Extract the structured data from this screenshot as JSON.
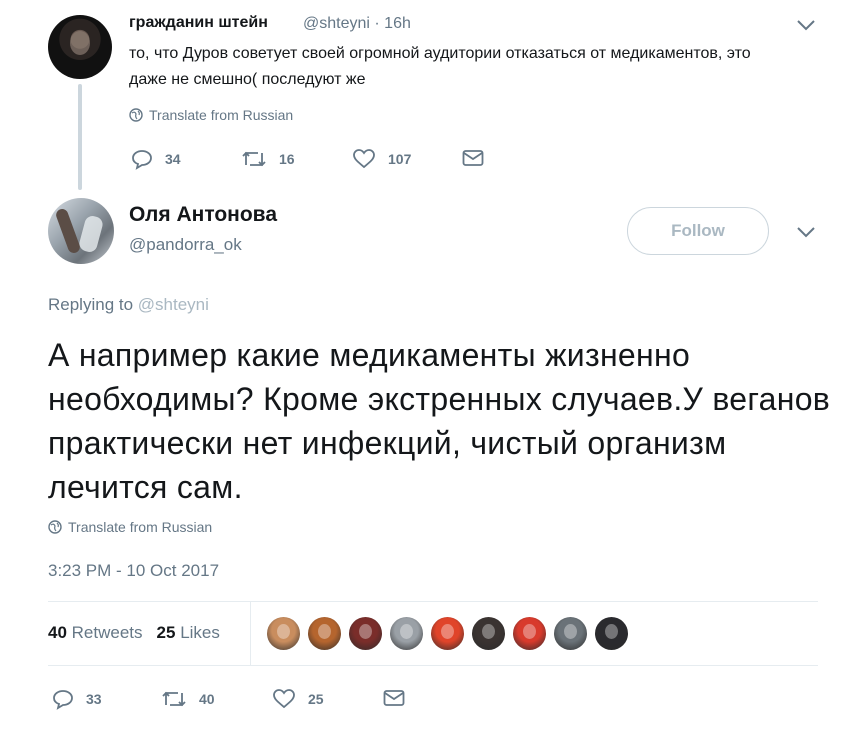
{
  "parent_tweet": {
    "name": "гражданин штейн",
    "handle": "@shteyni",
    "time": "16h",
    "text": "то, что Дуров советует своей огромной аудитории отказаться от медикаментов, это даже не смешно( последуют же",
    "translate_label": "Translate from Russian",
    "replies": "34",
    "retweets": "16",
    "likes": "107"
  },
  "main_tweet": {
    "name": "Оля Антонова",
    "handle": "@pandorra_ok",
    "follow_label": "Follow",
    "replying_prefix": "Replying to",
    "replying_to": "@shteyni",
    "text": "А например какие медикаменты жизненно необходимы? Кроме экстренных случаев.У веганов практически нет инфекций, чистый организм лечится сам.",
    "translate_label": "Translate from Russian",
    "timestamp": "3:23 PM - 10 Oct 2017",
    "retweets_count": "40",
    "retweets_label": "Retweets",
    "likes_count": "25",
    "likes_label": "Likes",
    "replies": "33",
    "retweets": "40",
    "likes": "25",
    "liker_avatar_colors": [
      "#c98d5e",
      "#b5652e",
      "#7a2d2a",
      "#9aa0a6",
      "#e0442a",
      "#3a3331",
      "#d83a2c",
      "#6a7278",
      "#2a2a2e"
    ]
  },
  "colors": {
    "secondary_text": "#657786",
    "divider": "#e6ecf0",
    "follow_border": "#ccd6dd"
  }
}
